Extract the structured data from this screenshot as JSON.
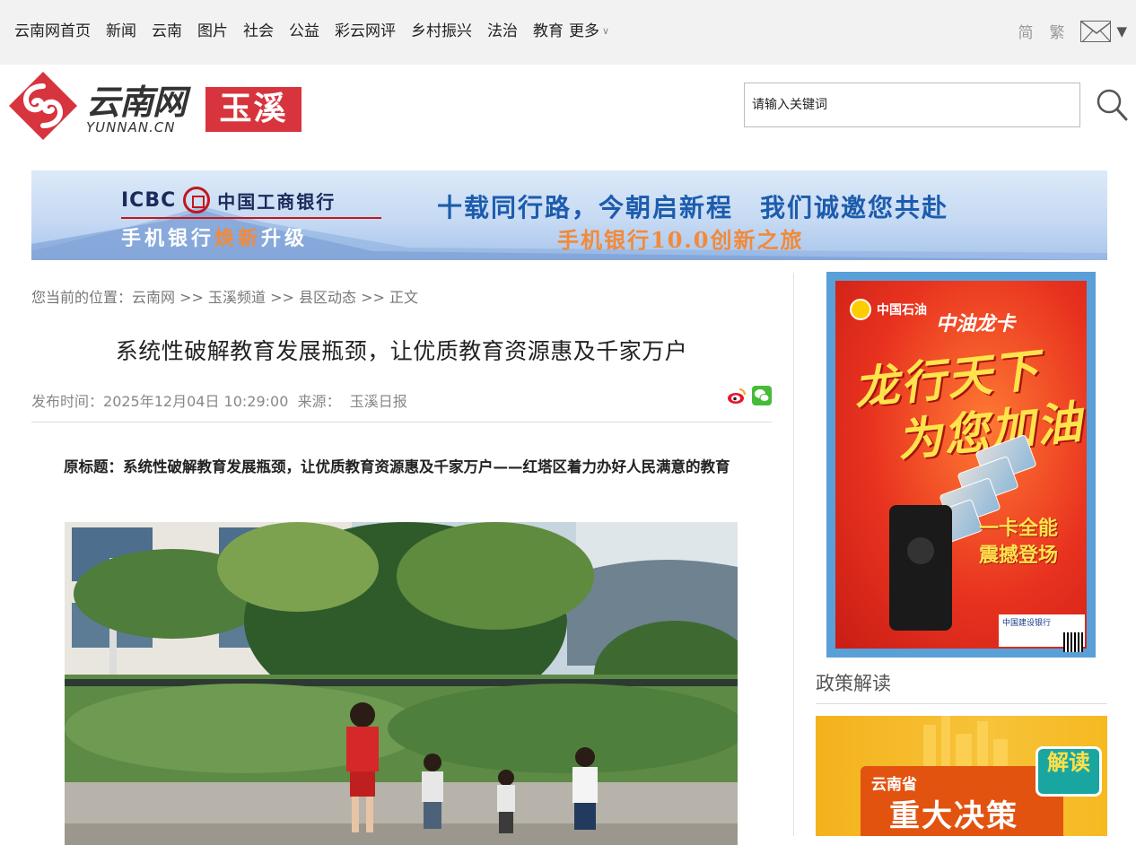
{
  "topnav": {
    "links": [
      "云南网首页",
      "新闻",
      "云南",
      "图片",
      "社会",
      "公益",
      "彩云网评",
      "乡村振兴",
      "法治",
      "教育"
    ],
    "more_label": "更多",
    "lang_simplified": "简",
    "lang_traditional": "繁"
  },
  "header": {
    "logo_cn": "云南网",
    "logo_en": "YUNNAN.CN",
    "channel": "玉溪",
    "search_placeholder": "请输入关键词"
  },
  "banner": {
    "icbc_en": "ICBC",
    "icbc_cn": "中国工商银行",
    "mobile_prefix": "手机银行",
    "mobile_highlight": "焕新",
    "mobile_suffix": "升级",
    "slogan_main": "十载同行路，今朝启新程　我们诚邀您共赴",
    "slogan_sub": "手机银行10.0创新之旅"
  },
  "article": {
    "breadcrumb_prefix": "您当前的位置：",
    "breadcrumb": [
      "云南网",
      "玉溪频道",
      "县区动态",
      "正文"
    ],
    "breadcrumb_sep": " >> ",
    "title": "系统性破解教育发展瓶颈，让优质教育资源惠及千家万户",
    "publish_label": "发布时间：",
    "publish_time": "2025年12月04日 10:29:00",
    "source_label": "来源：",
    "source": "玉溪日报",
    "lead": "原标题：系统性破解教育发展瓶颈，让优质教育资源惠及千家万户——红塔区着力办好人民满意的教育"
  },
  "sidebar": {
    "ad1_brand": "中国石油",
    "ad1_card": "中油龙卡",
    "ad1_slogan_line1": "龙行天下",
    "ad1_slogan_line2": "为您加油",
    "ad1_slogan_line3": "一卡全能",
    "ad1_slogan_line4": "震撼登场",
    "ad1_bank": "中国建设银行",
    "section_title": "政策解读",
    "ad2_line1": "云南省",
    "ad2_line2": "重大决策",
    "ad2_badge": "解读"
  },
  "colors": {
    "brand_red": "#d7343d",
    "banner_blue": "#1d5cad",
    "banner_orange": "#f18a3a"
  }
}
